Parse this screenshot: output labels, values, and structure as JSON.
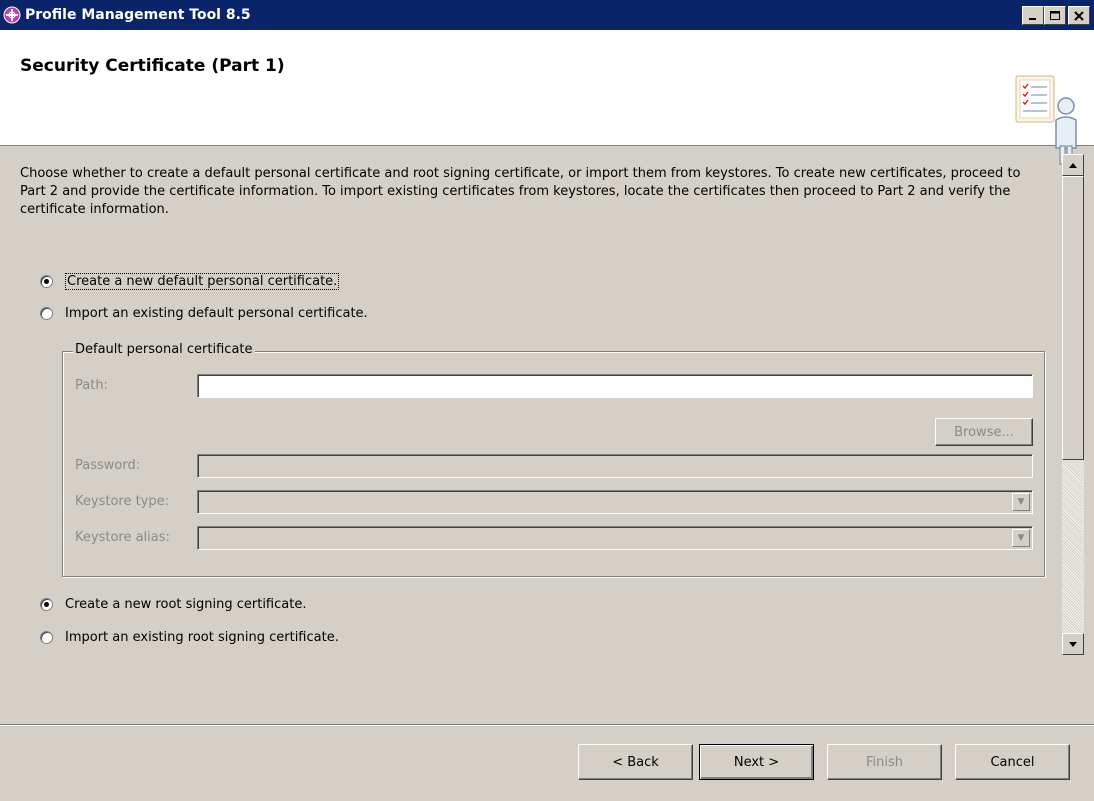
{
  "window": {
    "title": "Profile Management Tool 8.5",
    "minimize": "_",
    "maximize": "□",
    "close": "×"
  },
  "header": {
    "title": "Security Certificate (Part 1)"
  },
  "description": "Choose whether to create a default personal certificate and root signing certificate, or import them from keystores. To create new certificates, proceed to Part 2 and provide the certificate information. To import existing certificates from keystores, locate the certificates then proceed to Part 2 and verify the certificate information.",
  "personal_options": [
    {
      "label": "Create a new default personal certificate.",
      "selected": true
    },
    {
      "label": "Import an existing default personal certificate.",
      "selected": false
    }
  ],
  "group": {
    "legend": "Default personal certificate",
    "path_label": "Path:",
    "path_value": "",
    "browse_label": "Browse...",
    "password_label": "Password:",
    "keystore_type_label": "Keystore type:",
    "keystore_alias_label": "Keystore alias:"
  },
  "root_options": [
    {
      "label": "Create a new root signing certificate.",
      "selected": true
    },
    {
      "label": "Import an existing root signing certificate.",
      "selected": false
    }
  ],
  "buttons": {
    "back": "< Back",
    "next": "Next >",
    "finish": "Finish",
    "cancel": "Cancel"
  }
}
